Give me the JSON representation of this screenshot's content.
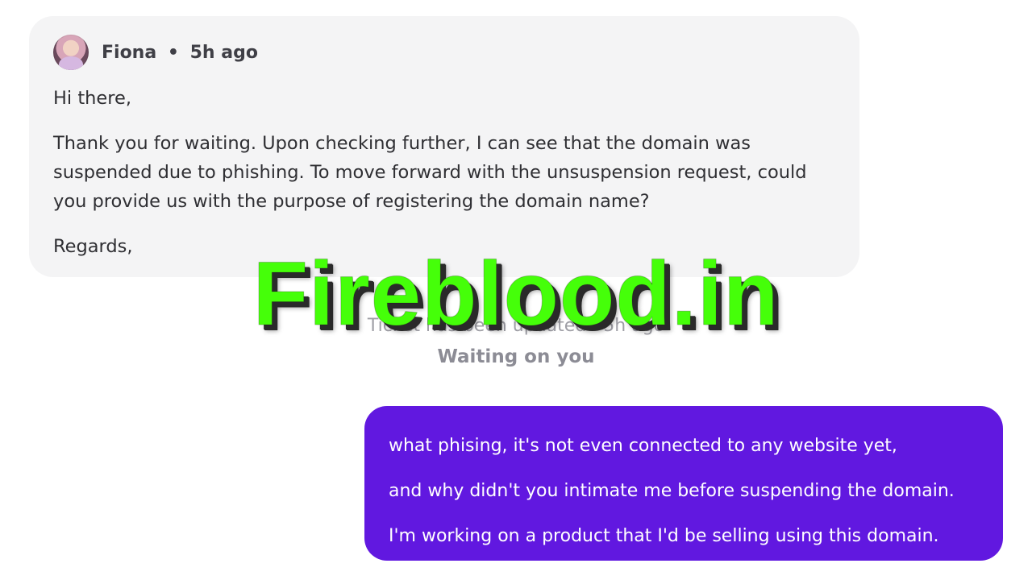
{
  "agent_message": {
    "author": "Fiona",
    "separator": "•",
    "time": "5h ago",
    "greeting": "Hi there,",
    "body_lines": [
      "Thank you for waiting. Upon checking further, I can see that the domain was",
      "suspended due to phishing. To move forward with the unsuspension request, could",
      "you provide us with the purpose of registering the domain name?"
    ],
    "closing": "Regards,"
  },
  "status": {
    "top": "Ticket has been updated · 5h ago",
    "main": "Waiting on you"
  },
  "user_message": {
    "lines": [
      "what phising, it's not even connected to any website yet,",
      "and why didn't you intimate me before suspending the domain.",
      "I'm working on a product that I'd be selling using this domain."
    ]
  },
  "watermark": {
    "text": "Fireblood.in"
  },
  "colors": {
    "agent_card_bg": "#f4f4f5",
    "user_bubble_bg": "#6118e0",
    "watermark": "#45ff09"
  },
  "icons": {
    "avatar": "user-avatar"
  }
}
